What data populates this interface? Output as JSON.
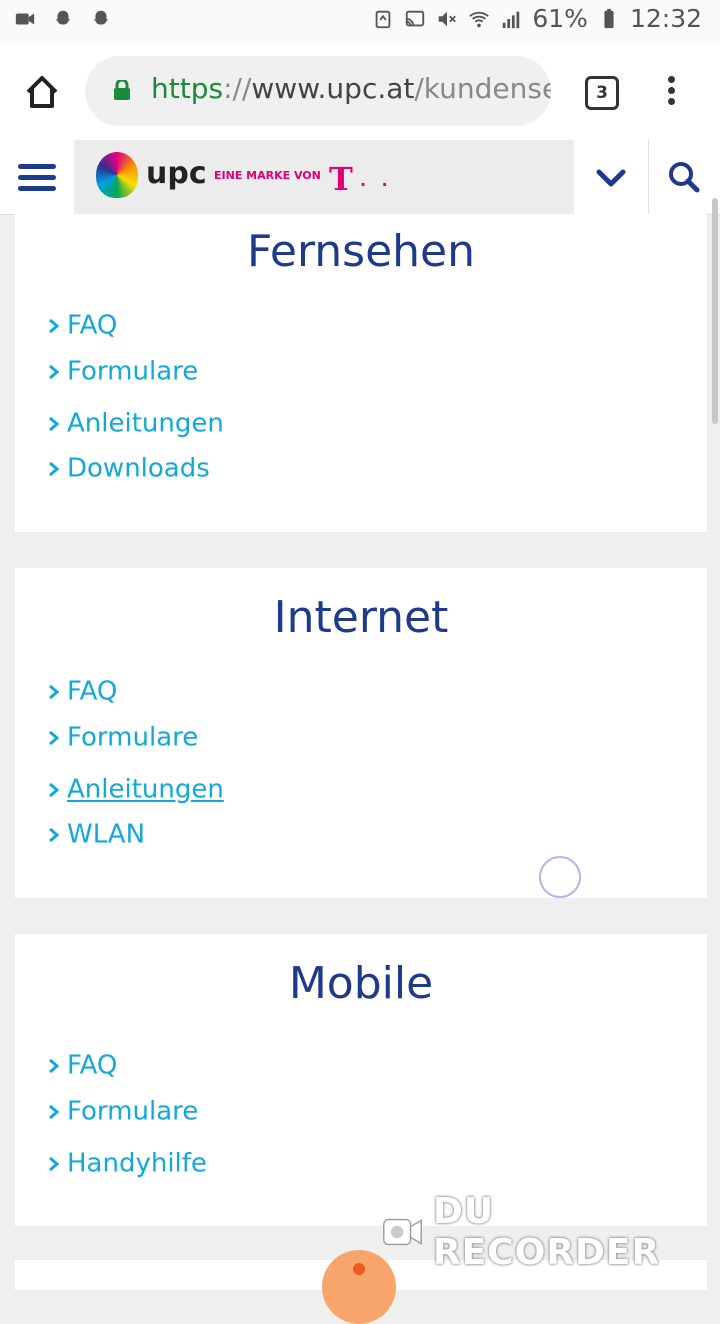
{
  "status_bar": {
    "left_icons": [
      "video-call-icon",
      "snapchat-icon",
      "snapchat-icon"
    ],
    "battery": "61%",
    "time": "12:32"
  },
  "browser": {
    "url_scheme": "https",
    "url_separator": "://",
    "url_host": "www.upc.at",
    "url_path": "/kundenser",
    "tab_count": "3"
  },
  "site": {
    "brand": "upc",
    "marke_label": "EINE MARKE VON",
    "t_logo": "T",
    "t_dots": "· ·"
  },
  "sections": [
    {
      "title": "Fernsehen",
      "links": [
        "FAQ",
        "Formulare",
        "Anleitungen",
        "Downloads"
      ]
    },
    {
      "title": "Internet",
      "links": [
        "FAQ",
        "Formulare",
        "Anleitungen",
        "WLAN"
      ]
    },
    {
      "title": "Mobile",
      "links": [
        "FAQ",
        "Formulare",
        "Handyhilfe"
      ]
    }
  ],
  "watermark": {
    "text": "DU RECORDER"
  },
  "colors": {
    "brand_blue": "#1f3a8a",
    "link_cyan": "#12a8d7",
    "telekom_magenta": "#e20074"
  }
}
